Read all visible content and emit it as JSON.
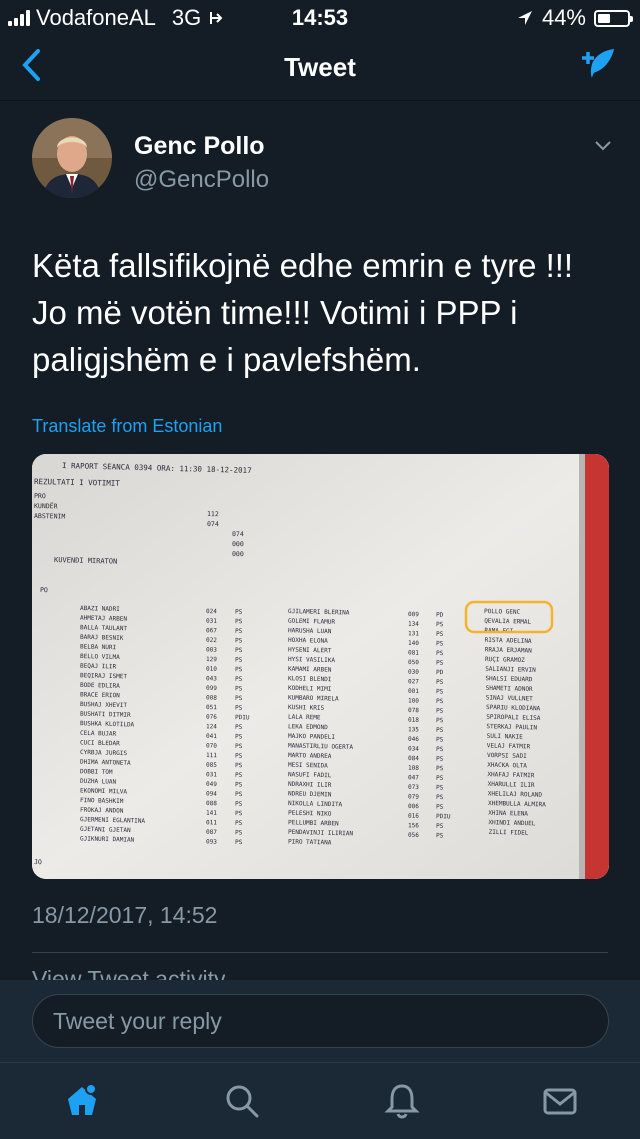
{
  "status": {
    "carrier": "VodafoneAL",
    "network": "3G",
    "time": "14:53",
    "battery": "44%",
    "battery_level": 0.44
  },
  "nav": {
    "title": "Tweet"
  },
  "tweet": {
    "author_name": "Genc Pollo",
    "author_handle": "@GencPollo",
    "text_lines": [
      "Këta fallsifikojnë edhe emrin e tyre !!!",
      "Jo më votën time!!! Votimi i PPP i",
      "paligjshëm e i pavlefshëm."
    ],
    "translate_label": "Translate from Estonian",
    "timestamp": "18/12/2017, 14:52",
    "activity_label": "View Tweet activity"
  },
  "document": {
    "header": "I RAPORT SEANCA 0394     ORA: 11:30 18-12-2017",
    "subheader": "REZULTATI I VOTIMIT",
    "tallies": [
      {
        "label": "PRO",
        "value": "112"
      },
      {
        "label": "KUNDËR",
        "value": "074"
      },
      {
        "label": "ABSTENIM",
        "value": "074"
      },
      {
        "label": "",
        "value": "000"
      },
      {
        "label": "",
        "value": "000"
      }
    ],
    "verdict": "KUVENDI MIRATON",
    "column_label": "PO",
    "columns": [
      [
        [
          "ABAZI NADRI",
          "024",
          "PS"
        ],
        [
          "AHMETAJ ARBEN",
          "031",
          "PS"
        ],
        [
          "BALLA TAULANT",
          "067",
          "PS"
        ],
        [
          "BARAJ BESNIK",
          "022",
          "PS"
        ],
        [
          "BELBA NURI",
          "003",
          "PS"
        ],
        [
          "BELLO VILMA",
          "129",
          "PS"
        ],
        [
          "BEQAJ ILIR",
          "010",
          "PS"
        ],
        [
          "BEQIRAJ ISMET",
          "043",
          "PS"
        ],
        [
          "BODE EDLIRA",
          "099",
          "PS"
        ],
        [
          "BRACE ERION",
          "008",
          "PS"
        ],
        [
          "BUSHAJ XHEVIT",
          "051",
          "PS"
        ],
        [
          "BUSHATI DITMIR",
          "076",
          "PDIU"
        ],
        [
          "BUSHKA KLOTILDA",
          "124",
          "PS"
        ],
        [
          "CELA BUJAR",
          "041",
          "PS"
        ],
        [
          "CUCI BLEDAR",
          "070",
          "PS"
        ],
        [
          "CYRBJA JURGIS",
          "111",
          "PS"
        ],
        [
          "DHIMA ANTONETA",
          "085",
          "PS"
        ],
        [
          "DOBBI TOM",
          "031",
          "PS"
        ],
        [
          "DUZHA LUAN",
          "049",
          "PS"
        ],
        [
          "EKONOMI MILVA",
          "094",
          "PS"
        ],
        [
          "FINO BASHKIM",
          "088",
          "PS"
        ],
        [
          "FROKAJ ANDON",
          "141",
          "PS"
        ],
        [
          "GJERMENI EGLANTINA",
          "011",
          "PS"
        ],
        [
          "GJETANI GJETAN",
          "087",
          "PS"
        ],
        [
          "GJIKNURI DAMIAN",
          "093",
          "PS"
        ]
      ],
      [
        [
          "GJILAMERI BLERINA",
          "009",
          "PD"
        ],
        [
          "GOLEMI FLAMUR",
          "134",
          "PS"
        ],
        [
          "HARUSHA LUAN",
          "131",
          "PS"
        ],
        [
          "HOXHA ELONA",
          "140",
          "PS"
        ],
        [
          "HYSENI ALERT",
          "081",
          "PS"
        ],
        [
          "HYSI VASILIKA",
          "050",
          "PS"
        ],
        [
          "KAMAMI ARBEN",
          "030",
          "PD"
        ],
        [
          "KLOSI BLENDI",
          "027",
          "PS"
        ],
        [
          "KODHELI MIMI",
          "001",
          "PS"
        ],
        [
          "KUMBARO MIRELA",
          "100",
          "PS"
        ],
        [
          "KUSHI KRIS",
          "078",
          "PS"
        ],
        [
          "LALA REME",
          "018",
          "PS"
        ],
        [
          "LEKA EDMOND",
          "135",
          "PS"
        ],
        [
          "MAJKO PANDELI",
          "046",
          "PS"
        ],
        [
          "MANASTIRLIU OGERTA",
          "034",
          "PS"
        ],
        [
          "MARTO ANDREA",
          "084",
          "PS"
        ],
        [
          "MESI SENIDA",
          "108",
          "PS"
        ],
        [
          "NASUFI FADIL",
          "047",
          "PS"
        ],
        [
          "NDRAXHI ILIR",
          "073",
          "PS"
        ],
        [
          "NDREU DJEMIN",
          "079",
          "PS"
        ],
        [
          "NIKOLLA LINDITA",
          "006",
          "PS"
        ],
        [
          "PELESHI NIKO",
          "016",
          "PDIU"
        ],
        [
          "PELLUMBI ARBEN",
          "156",
          "PS"
        ],
        [
          "PENDAVINJI ILIRIAN",
          "056",
          "PS"
        ],
        [
          "PIRO TATIANA",
          "",
          ""
        ]
      ],
      [
        [
          "POLLO GENC",
          "",
          ""
        ],
        [
          "QEVALIA ERMAL",
          "",
          ""
        ],
        [
          "RAMA EGI",
          "",
          ""
        ],
        [
          "RISTA ADELINA",
          "",
          ""
        ],
        [
          "RRAJA ERJAMAN",
          "",
          ""
        ],
        [
          "RUÇI GRAMOZ",
          "",
          ""
        ],
        [
          "SALIANJI ERVIN",
          "",
          ""
        ],
        [
          "SHALSI EDUARD",
          "",
          ""
        ],
        [
          "SHAMETI ADNOR",
          "",
          ""
        ],
        [
          "SINAJ VULLNET",
          "",
          ""
        ],
        [
          "SPARIU KLODIANA",
          "",
          ""
        ],
        [
          "SPIROPALI ELISA",
          "",
          ""
        ],
        [
          "STERKAJ PAULIN",
          "",
          ""
        ],
        [
          "SULI NAKIE",
          "",
          ""
        ],
        [
          "VELAJ FATMIR",
          "",
          ""
        ],
        [
          "VORPSI SADI",
          "",
          ""
        ],
        [
          "XHACKA OLTA",
          "",
          ""
        ],
        [
          "XHAFAJ FATMIR",
          "",
          ""
        ],
        [
          "XHARULLI ILIR",
          "",
          ""
        ],
        [
          "XHELILAJ ROLAND",
          "",
          ""
        ],
        [
          "XHEMBULLA ALMIRA",
          "",
          ""
        ],
        [
          "XHINA ELENA",
          "",
          ""
        ],
        [
          "XHINDI ANDUEL",
          "",
          ""
        ],
        [
          "ZILLI FIDEL",
          "",
          ""
        ]
      ]
    ]
  },
  "reply": {
    "placeholder": "Tweet your reply"
  },
  "colors": {
    "accent": "#1da1f2",
    "background": "#141d26",
    "muted": "#8899a6",
    "highlight": "#f5b32c"
  }
}
